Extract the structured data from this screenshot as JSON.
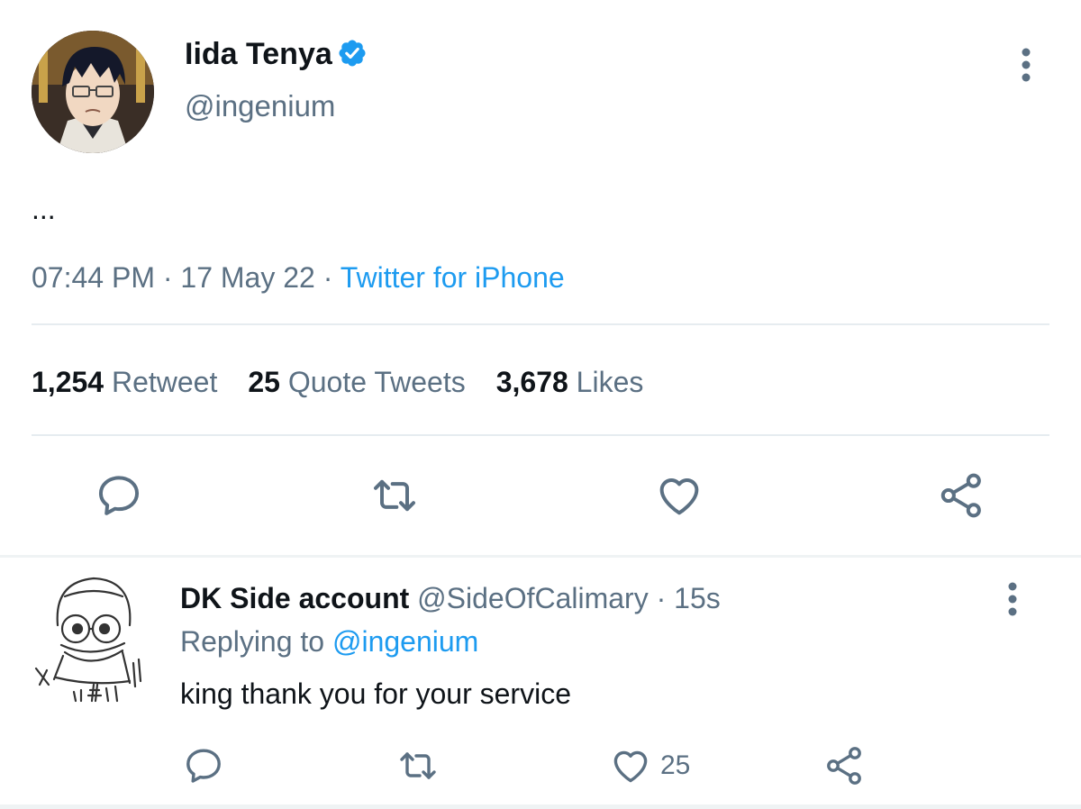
{
  "tweet": {
    "author_name": "Iida Tenya",
    "author_handle": "@ingenium",
    "verified": true,
    "text": "...",
    "time": "07:44 PM",
    "date": "17 May 22",
    "source": "Twitter for iPhone",
    "separator": "·",
    "stats": {
      "retweets_count": "1,254",
      "retweets_label": "Retweet",
      "quotes_count": "25",
      "quotes_label": "Quote Tweets",
      "likes_count": "3,678",
      "likes_label": "Likes"
    }
  },
  "reply": {
    "author_name": "DK Side account",
    "author_handle": "@SideOfCalimary",
    "age": "15s",
    "replying_prefix": "Replying to",
    "replying_to": "@ingenium",
    "text": "king thank you for your service",
    "like_count": "25"
  },
  "icons": {
    "reply": "comment-bubble-icon",
    "retweet": "retweet-icon",
    "like": "heart-icon",
    "share": "share-icon",
    "more": "more-vertical-icon",
    "verified": "verified-badge-icon"
  },
  "colors": {
    "accent": "#1d9bf0",
    "secondary_text": "#5b7083",
    "primary_text": "#0f1419",
    "divider": "#e6ecf0"
  }
}
